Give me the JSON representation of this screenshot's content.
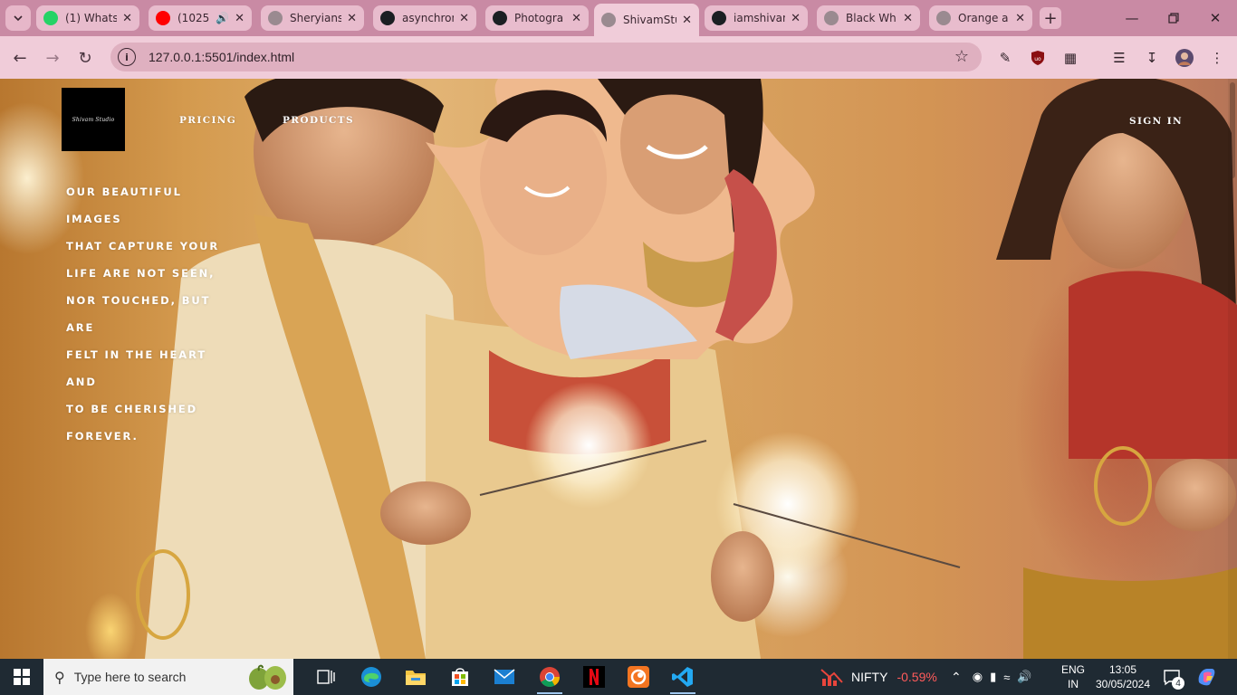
{
  "browser": {
    "tabs": [
      {
        "title": "(1) Whats",
        "icon": "whatsapp-icon",
        "color": "#25d366",
        "active": false
      },
      {
        "title": "(1025",
        "icon": "youtube-icon",
        "color": "#ff0000",
        "active": false,
        "sound": true
      },
      {
        "title": "Sheryians",
        "icon": "globe-icon",
        "color": "#9a8a90",
        "active": false
      },
      {
        "title": "asynchron",
        "icon": "github-icon",
        "color": "#1b1f23",
        "active": false
      },
      {
        "title": "Photogra",
        "icon": "github-icon",
        "color": "#1b1f23",
        "active": false
      },
      {
        "title": "ShivamStu",
        "icon": "globe-icon",
        "color": "#9a8a90",
        "active": true
      },
      {
        "title": "iamshivan",
        "icon": "github-icon",
        "color": "#1b1f23",
        "active": false
      },
      {
        "title": "Black Wh",
        "icon": "globe-icon",
        "color": "#9a8a90",
        "active": false
      },
      {
        "title": "Orange a",
        "icon": "globe-icon",
        "color": "#9a8a90",
        "active": false
      }
    ],
    "url": "127.0.0.1:5501/index.html"
  },
  "site": {
    "logo_text": "Shivam Studio",
    "nav": {
      "pricing": "PRICING",
      "products": "PRODUCTS",
      "sign_in": "SIGN IN"
    },
    "hero_lines": [
      "OUR BEAUTIFUL IMAGES",
      "THAT CAPTURE YOUR",
      "LIFE ARE NOT SEEN,",
      "NOR TOUCHED, BUT ARE",
      "FELT IN THE HEART AND",
      "TO BE CHERISHED",
      "FOREVER."
    ]
  },
  "taskbar": {
    "search_placeholder": "Type here to search",
    "apps": [
      "task-view",
      "edge",
      "file-explorer",
      "microsoft-store",
      "mail",
      "chrome",
      "netflix",
      "crunchyroll",
      "vs-code"
    ],
    "nifty": {
      "label": "NIFTY",
      "change": "-0.59%",
      "color": "#ff5b5b"
    },
    "lang": {
      "line1": "ENG",
      "line2": "IN"
    },
    "time": "13:05",
    "date": "30/05/2024",
    "notifications": "4"
  }
}
